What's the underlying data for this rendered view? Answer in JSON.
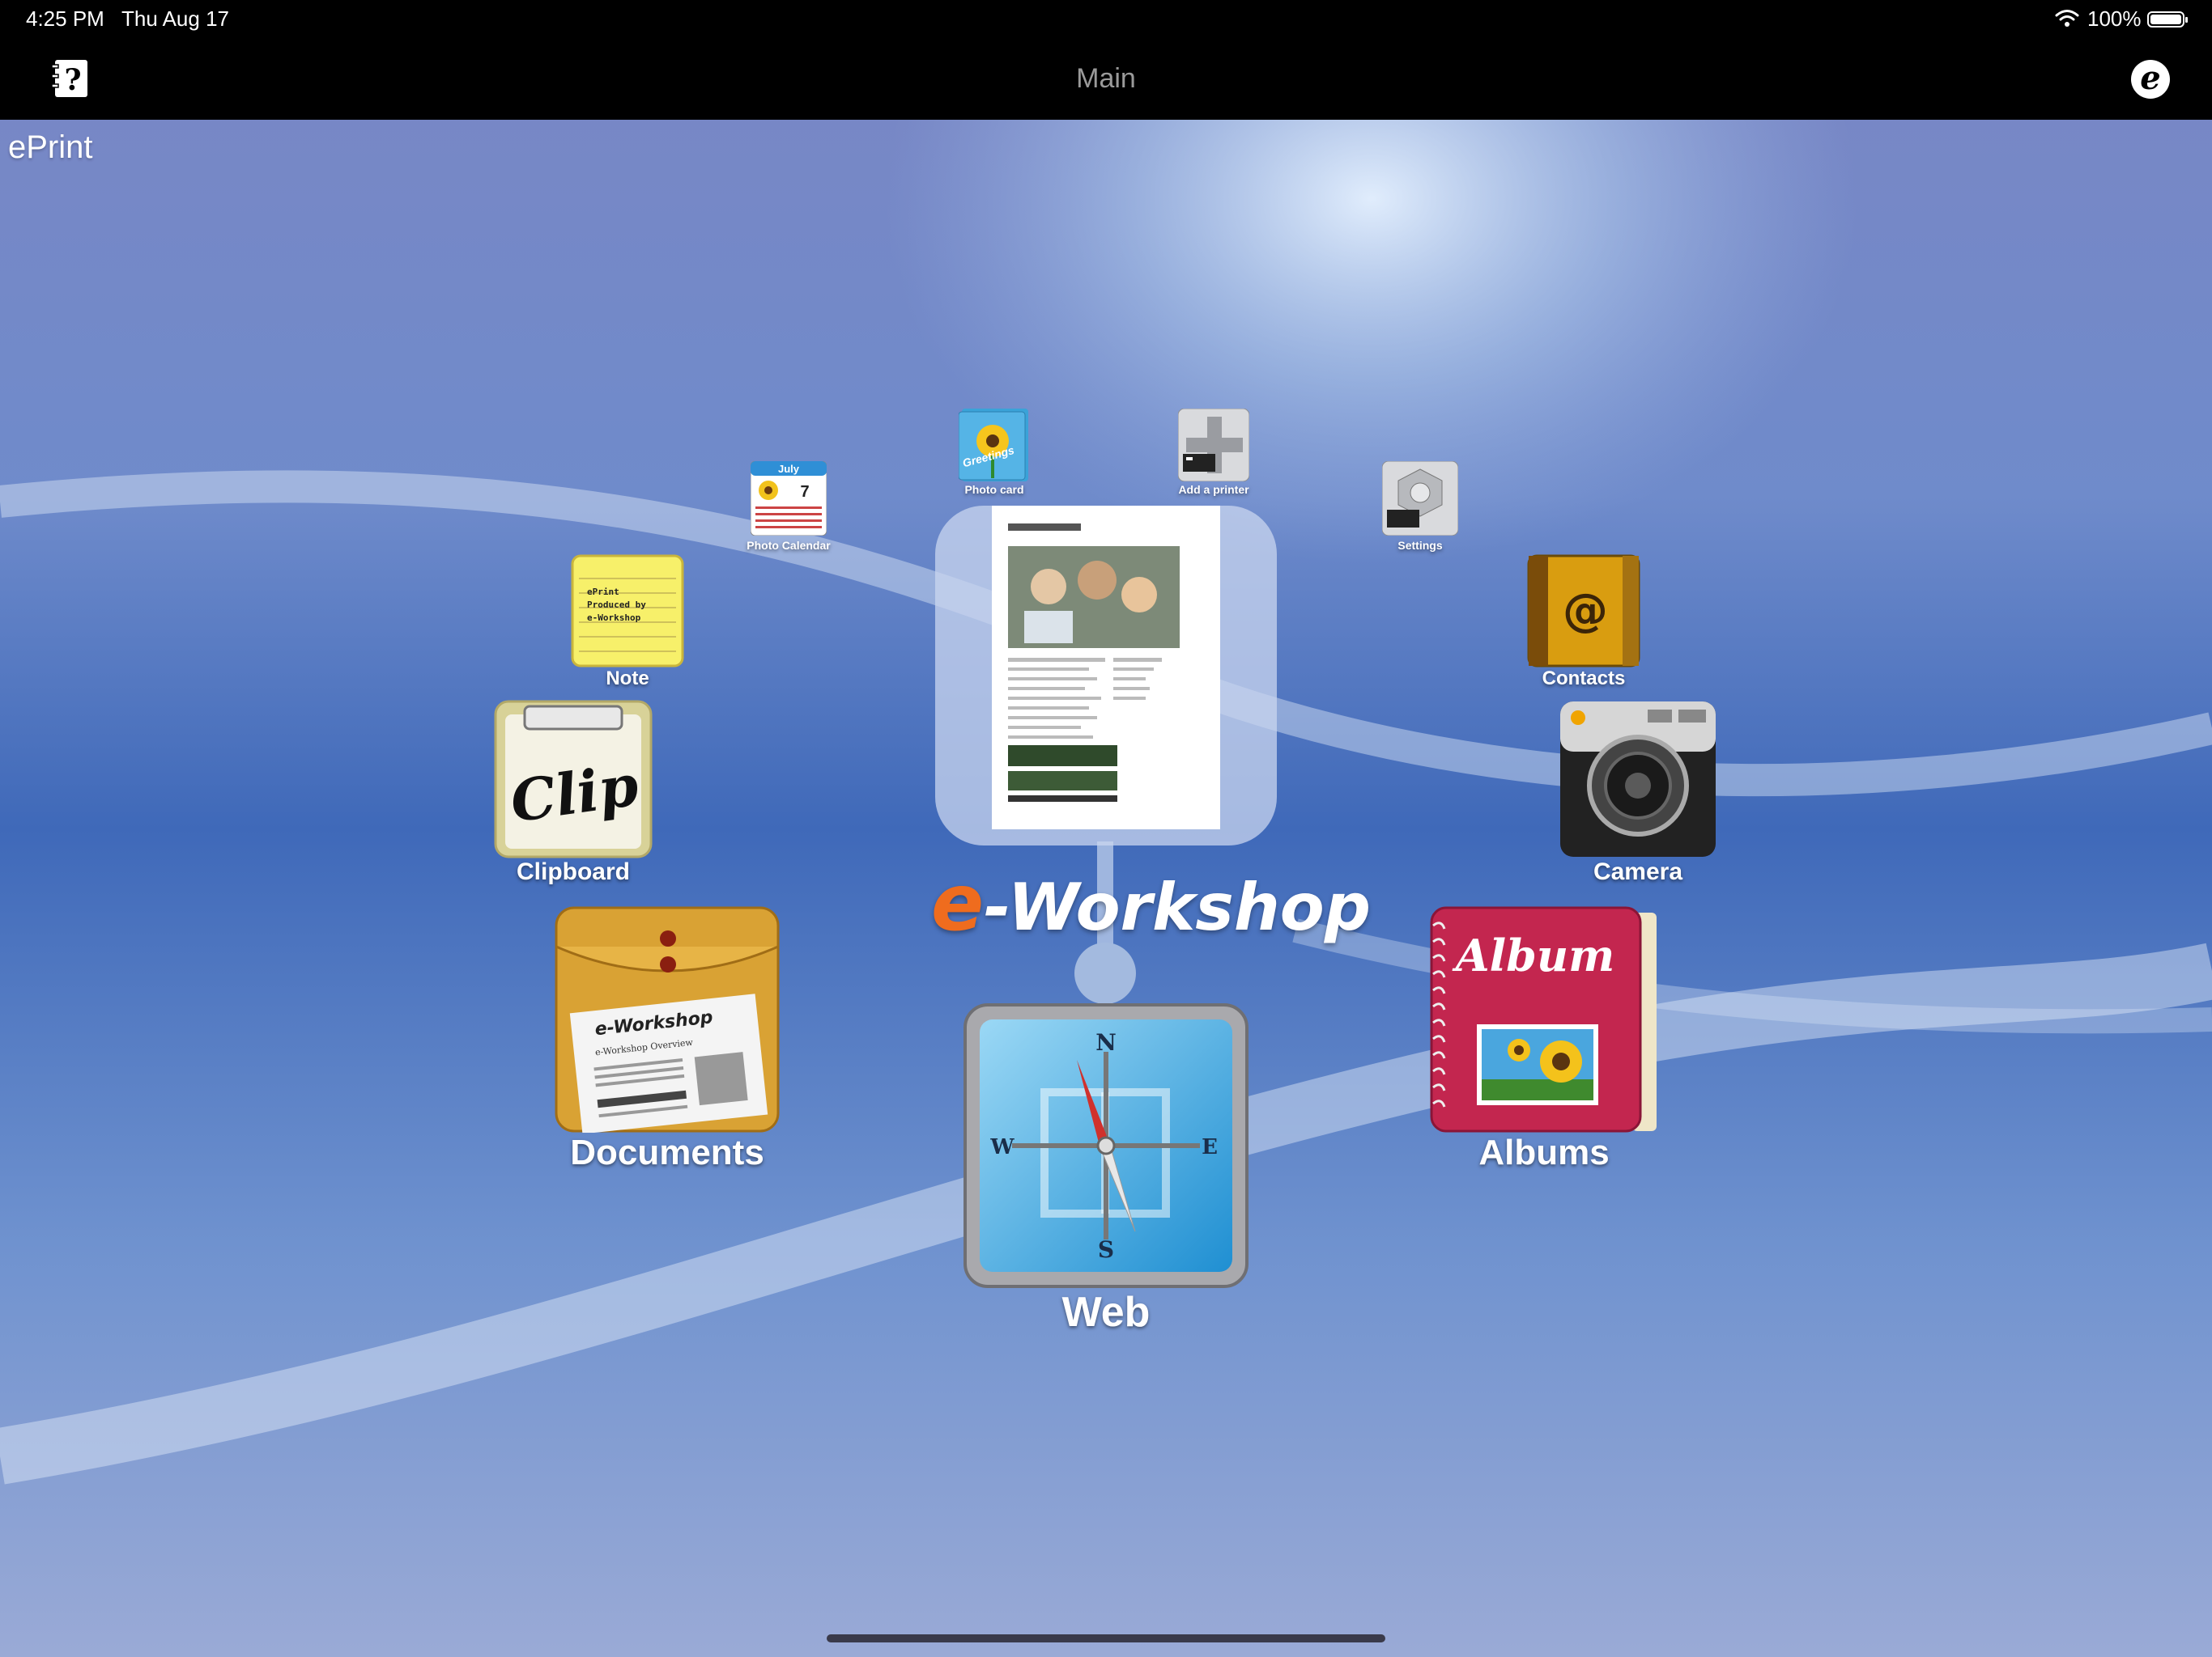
{
  "status_bar": {
    "time": "4:25 PM",
    "date": "Thu Aug 17",
    "battery": "100%"
  },
  "nav": {
    "title": "Main",
    "help_icon": "help-book-icon",
    "logo_icon": "e-workshop-logo-icon"
  },
  "app_name": "ePrint",
  "center": {
    "brand_letter": "e",
    "brand_rest": "-Workshop"
  },
  "small_items": [
    {
      "label": "Photo Calendar",
      "icon": "calendar-icon"
    },
    {
      "label": "Photo card",
      "icon": "photo-card-icon"
    },
    {
      "label": "Add a printer",
      "icon": "add-printer-icon"
    },
    {
      "label": "Settings",
      "icon": "settings-icon"
    }
  ],
  "medium_items": [
    {
      "label": "Note",
      "icon": "note-icon"
    },
    {
      "label": "Contacts",
      "icon": "contacts-icon"
    },
    {
      "label": "Clipboard",
      "icon": "clipboard-icon"
    },
    {
      "label": "Camera",
      "icon": "camera-icon"
    }
  ],
  "large_items": [
    {
      "label": "Documents",
      "icon": "documents-icon"
    },
    {
      "label": "Albums",
      "icon": "albums-icon"
    },
    {
      "label": "Web",
      "icon": "compass-icon"
    }
  ],
  "icon_text": {
    "calendar_month": "July",
    "calendar_day": "7",
    "photo_card_word": "Greetings",
    "note_lines": [
      "ePrint",
      "Produced by",
      "e-Workshop"
    ],
    "contacts_symbol": "@",
    "clipboard_word": "Clip",
    "documents_brand": "e-Workshop",
    "documents_subtitle": "e-Workshop Overview",
    "album_word": "Album",
    "compass_n": "N",
    "compass_s": "S",
    "compass_e": "E",
    "compass_w": "W"
  },
  "colors": {
    "accent_orange": "#ef6c1e",
    "nav_bg": "#000000",
    "sky_blue": "#3f69b9"
  }
}
